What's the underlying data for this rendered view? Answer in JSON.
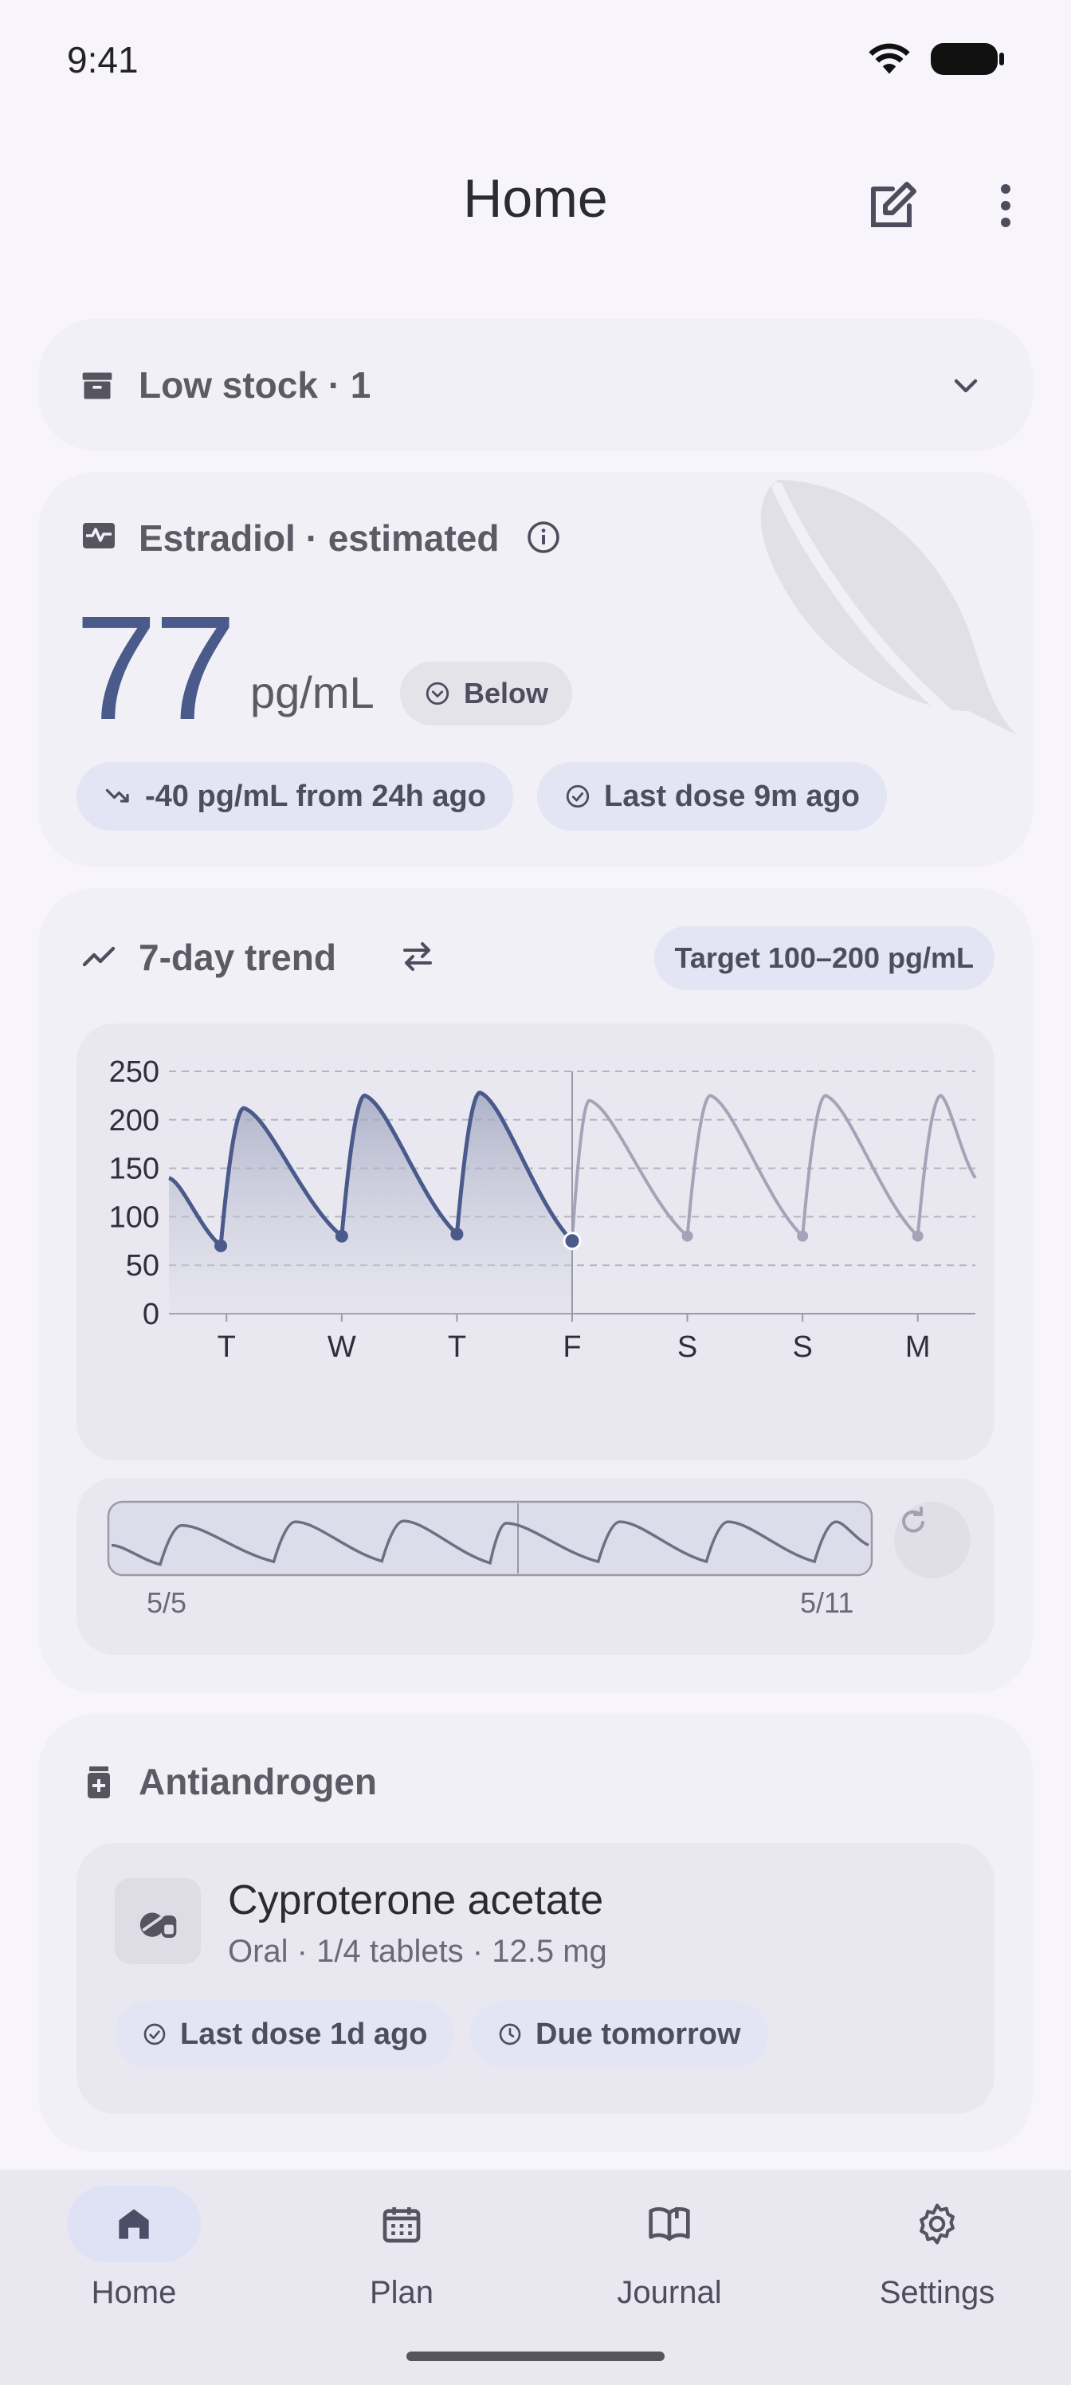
{
  "status_bar": {
    "time": "9:41"
  },
  "header": {
    "title": "Home"
  },
  "low_stock": {
    "label": "Low stock · 1"
  },
  "estradiol": {
    "title": "Estradiol · estimated",
    "value": "77",
    "unit": "pg/mL",
    "status": "Below",
    "change": "-40 pg/mL from 24h ago",
    "last_dose": "Last dose 9m ago"
  },
  "trend": {
    "title": "7-day trend",
    "target": "Target 100–200 pg/mL",
    "range_start": "5/5",
    "range_end": "5/11"
  },
  "chart_data": {
    "type": "line",
    "x_ticks": [
      "T",
      "W",
      "T",
      "F",
      "S",
      "S",
      "M"
    ],
    "y_ticks": [
      "250",
      "200",
      "150",
      "100",
      "50",
      "0"
    ],
    "ylim": [
      0,
      250
    ],
    "grid": true,
    "series": [
      {
        "values": [
          [
            0,
            140
          ],
          [
            0.45,
            70
          ],
          [
            0.65,
            212
          ],
          [
            1.5,
            80
          ],
          [
            1.7,
            225
          ],
          [
            2.5,
            82
          ],
          [
            2.7,
            228
          ],
          [
            3.5,
            75
          ]
        ]
      },
      {
        "values": [
          [
            3.5,
            75
          ],
          [
            3.65,
            220
          ],
          [
            4.5,
            80
          ],
          [
            4.7,
            225
          ],
          [
            5.5,
            80
          ],
          [
            5.7,
            225
          ],
          [
            6.5,
            80
          ],
          [
            6.7,
            225
          ],
          [
            7.0,
            140
          ]
        ]
      }
    ]
  },
  "antiandrogen": {
    "title": "Antiandrogen",
    "med_name": "Cyproterone acetate",
    "med_detail": "Oral · 1/4 tablets · 12.5 mg",
    "last_dose": "Last dose 1d ago",
    "due": "Due tomorrow"
  },
  "bottom_nav": {
    "items": [
      {
        "label": "Home",
        "icon": "home-icon"
      },
      {
        "label": "Plan",
        "icon": "calendar-icon"
      },
      {
        "label": "Journal",
        "icon": "book-icon"
      },
      {
        "label": "Settings",
        "icon": "gear-icon"
      }
    ]
  },
  "colors": {
    "accent": "#4a5a8a",
    "card": "#f1f0f6",
    "pill_blue": "#e3e5f5"
  }
}
